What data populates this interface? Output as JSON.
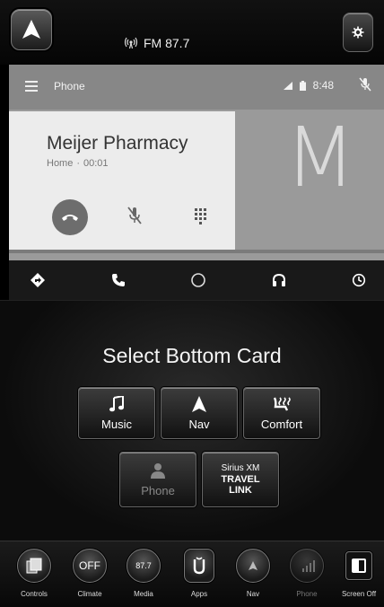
{
  "top_bar": {
    "radio_station": "FM 87.7",
    "radio_icon": "radio-signal-icon",
    "home_icon": "navigation-arrow-icon",
    "settings_icon": "settings-icon"
  },
  "android_auto": {
    "app_title": "Phone",
    "clock": "8:48",
    "status_icons": [
      "cellular-signal-icon",
      "battery-icon",
      "mic-off-icon"
    ],
    "call": {
      "contact_name": "Meijer Pharmacy",
      "number_type": "Home",
      "separator": "·",
      "duration": "00:01"
    },
    "avatar_letter": "M",
    "nav_icons": [
      "navigation-icon",
      "phone-icon",
      "home-circle-icon",
      "headphones-icon",
      "recents-icon"
    ]
  },
  "card_selection": {
    "title": "Select Bottom Card",
    "cards": {
      "music": "Music",
      "nav": "Nav",
      "comfort": "Comfort",
      "phone": "Phone",
      "sirius_line1": "Sirius XM",
      "sirius_line2": "TRAVEL",
      "sirius_line3": "LINK"
    }
  },
  "dock": {
    "controls": "Controls",
    "climate_state": "OFF",
    "climate": "Climate",
    "media_station": "87.7",
    "media": "Media",
    "apps": "Apps",
    "nav": "Nav",
    "phone": "Phone",
    "screen_off": "Screen Off"
  },
  "colors": {
    "card_background": "#ececec",
    "panel_background": "#9a9a9a",
    "header_background": "#878787",
    "end_call_button": "#6d6d6d"
  }
}
